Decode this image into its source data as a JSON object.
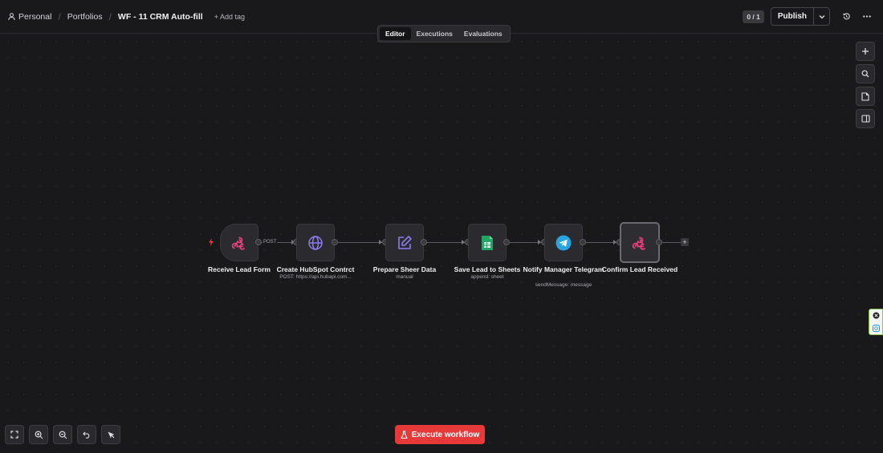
{
  "breadcrumb": {
    "personal": "Personal",
    "portfolios": "Portfolios",
    "workflow_name": "WF - 11 CRM Auto-fill",
    "add_tag": "+ Add tag"
  },
  "header": {
    "counter": "0 / 1",
    "publish_label": "Publish"
  },
  "tabs": [
    {
      "label": "Editor",
      "active": true
    },
    {
      "label": "Executions",
      "active": false
    },
    {
      "label": "Evaluations",
      "active": false
    }
  ],
  "side_tools": [
    "plus-icon",
    "search-icon",
    "sticky-note-icon",
    "panel-icon"
  ],
  "nodes": [
    {
      "title": "Receive Lead Form",
      "subtitle": "",
      "icon": "webhook-icon"
    },
    {
      "title": "Create HubSpot Contrct",
      "subtitle": "POST: https://api.hubapi.com...",
      "icon": "globe-icon"
    },
    {
      "title": "Prepare Sheer Data",
      "subtitle": "manual",
      "icon": "edit-icon"
    },
    {
      "title": "Save Lead to Sheets",
      "subtitle": "append: sheet",
      "icon": "sheets-icon"
    },
    {
      "title": "Notify Manager Telegram",
      "subtitle": "sendMessage: message",
      "icon": "telegram-icon"
    },
    {
      "title": "Confirm Lead Received",
      "subtitle": "",
      "icon": "webhook-icon"
    }
  ],
  "connection_label": "POST",
  "execute_label": "Execute workflow",
  "colors": {
    "background": "#19181b",
    "node_bg": "#2b2a2f",
    "execute_red": "#e5393a",
    "webhook_pink": "#e4407b",
    "globe_purple": "#8c7cf0",
    "sheets_green": "#23a566",
    "telegram_blue": "#2aa3df"
  }
}
